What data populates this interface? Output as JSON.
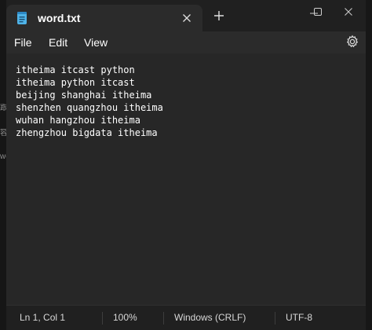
{
  "window": {
    "tab_title": "word.txt",
    "new_tab_label": "+",
    "controls": [
      "minimize",
      "maximize",
      "close"
    ]
  },
  "menu": {
    "file": "File",
    "edit": "Edit",
    "view": "View"
  },
  "editor": {
    "lines": [
      "itheima itcast python",
      "itheima python itcast",
      "beijing shanghai itheima",
      "shenzhen quangzhou itheima",
      "wuhan hangzhou itheima",
      "zhengzhou bigdata itheima"
    ]
  },
  "status": {
    "position": "Ln 1, Col 1",
    "zoom": "100%",
    "line_ending": "Windows (CRLF)",
    "encoding": "UTF-8"
  },
  "background_window": {
    "edge_fragments": [
      "跟",
      "容",
      "wo"
    ]
  },
  "colors": {
    "app_bg": "#202020",
    "tab_bg": "#2b2b2b",
    "editor_bg": "#272727",
    "doc_icon": "#4fb3e8",
    "text": "#ffffff"
  }
}
